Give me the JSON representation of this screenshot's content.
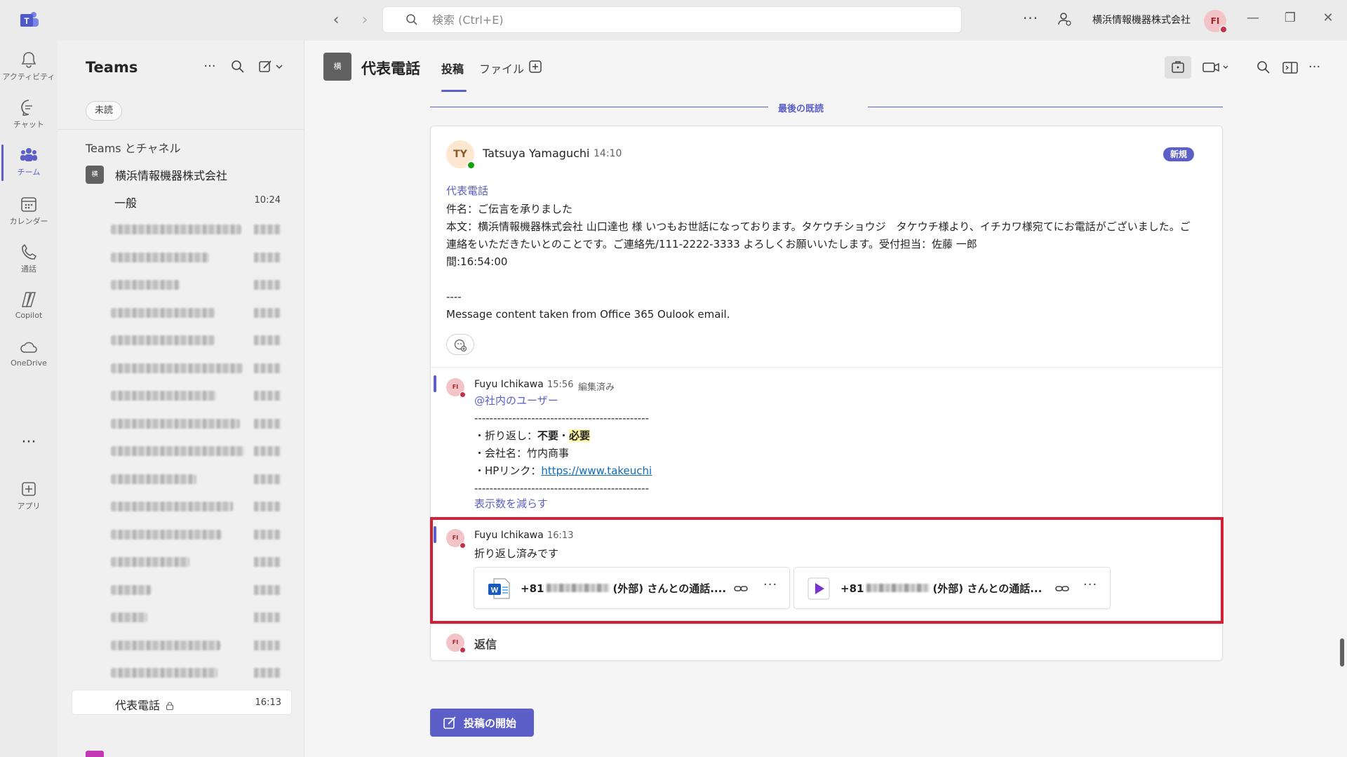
{
  "search": {
    "placeholder": "検索 (Ctrl+E)"
  },
  "topbar": {
    "org_name": "横浜情報機器株式会社",
    "avatar_initials": "FI"
  },
  "rail": [
    {
      "label": "アクティビティ",
      "icon": "bell-icon"
    },
    {
      "label": "チャット",
      "icon": "chat-icon"
    },
    {
      "label": "チーム",
      "icon": "teams-icon"
    },
    {
      "label": "カレンダー",
      "icon": "calendar-icon"
    },
    {
      "label": "通話",
      "icon": "phone-icon"
    },
    {
      "label": "Copilot",
      "icon": "copilot-icon"
    },
    {
      "label": "OneDrive",
      "icon": "cloud-icon"
    },
    {
      "label": "アプリ",
      "icon": "apps-icon"
    }
  ],
  "sidebar": {
    "title": "Teams",
    "filter": "未読",
    "section": "Teams とチャネル",
    "team": {
      "badge": "横",
      "name": "横浜情報機器株式会社"
    },
    "channels": [
      {
        "name": "一般",
        "time": "10:24"
      },
      {
        "name": "代表電話",
        "time": "16:13"
      }
    ]
  },
  "channel": {
    "avatar": "横",
    "title": "代表電話",
    "tabs": [
      "投稿",
      "ファイル"
    ]
  },
  "feed": {
    "last_read": "最後の既読",
    "root": {
      "initials": "TY",
      "author": "Tatsuya Yamaguchi",
      "time": "14:10",
      "badge": "新規",
      "subject": "代表電話",
      "lines": [
        "件名：ご伝言を承りました",
        "本文：横浜情報機器株式会社 山口達也 様 いつもお世話になっております。タケウチショウジ　タケウチ様より、イチカワ様宛てにお電話がございました。ご連絡をいただきたいとのことです。ご連絡先/111-2222-3333 よろしくお願いいたします。受付担当：佐藤 一郎",
        "間:16:54:00",
        "",
        "----",
        "Message content taken from Office 365 Oulook email."
      ]
    },
    "reply1": {
      "initials": "FI",
      "author": "Fuyu Ichikawa",
      "time": "15:56",
      "edited": "編集済み",
      "mention": "@社内のユーザー",
      "rule": "----------------------------------------------",
      "callback_label": "・折り返し：",
      "callback_no": "不要",
      "callback_sep": "・",
      "callback_yes": "必要",
      "company": "・会社名：竹内商事",
      "hp_label": "・HPリンク：",
      "hp_url": "https://www.takeuchi",
      "show_less": "表示数を減らす"
    },
    "reply2": {
      "initials": "FI",
      "author": "Fuyu Ichikawa",
      "time": "16:13",
      "text": "折り返し済みです",
      "attachments": [
        {
          "prefix": "+81",
          "suffix": "(外部) さんとの通話....",
          "type": "word-doc-icon"
        },
        {
          "prefix": "+81",
          "suffix": "(外部) さんとの通話...",
          "type": "video-icon"
        }
      ]
    },
    "reply_label": "返信",
    "reply_initials": "FI"
  },
  "start_post": "投稿の開始",
  "colors": {
    "accent": "#5b5fc7",
    "highlight_border": "#d32035",
    "mark": "#fff4a3"
  }
}
